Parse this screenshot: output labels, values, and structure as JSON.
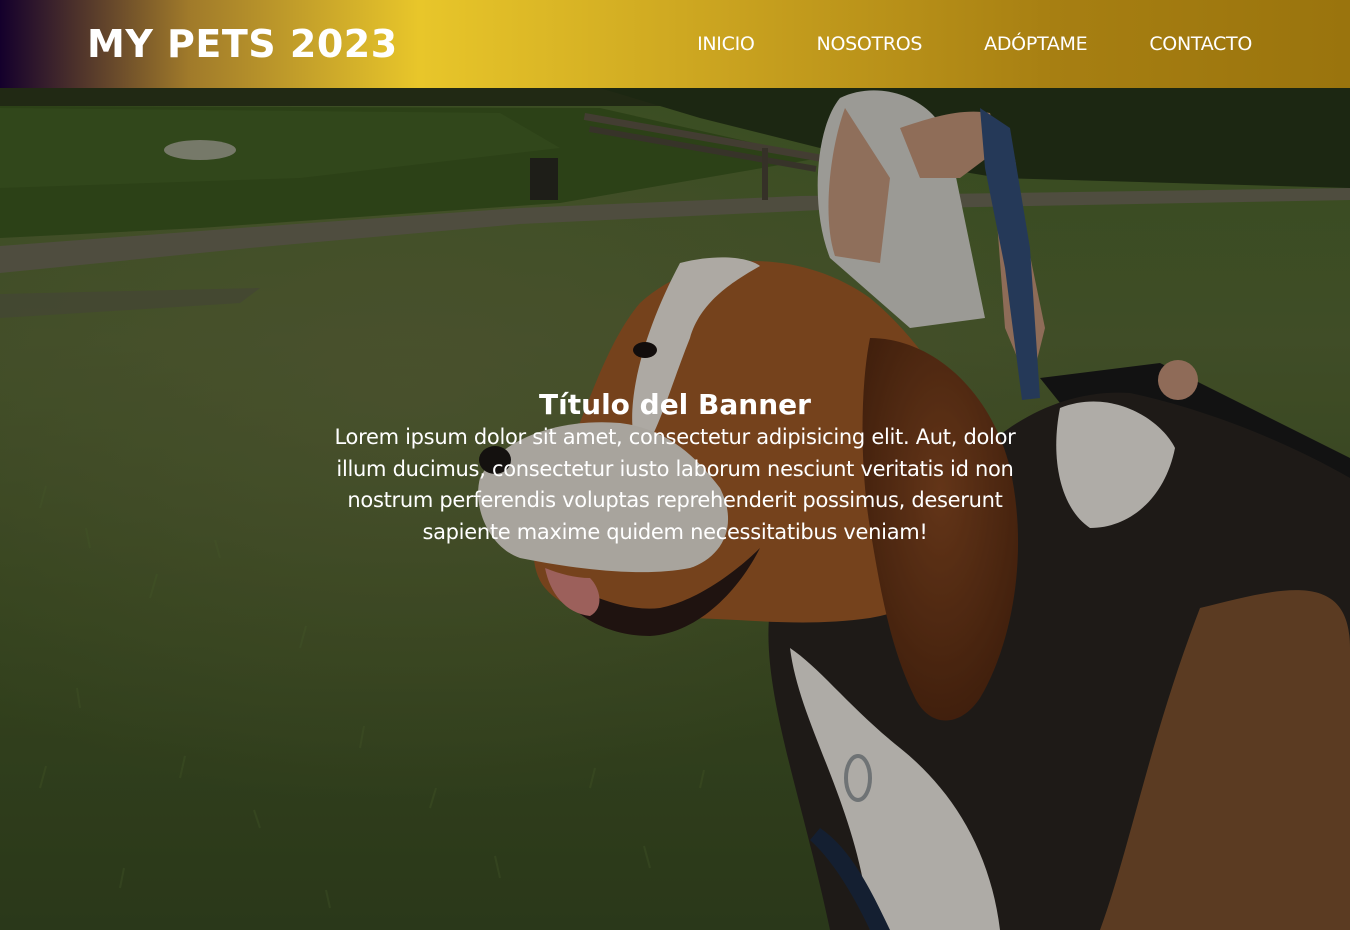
{
  "header": {
    "logo": "MY PETS 2023",
    "nav": [
      {
        "label": "INICIO"
      },
      {
        "label": "NOSOTROS"
      },
      {
        "label": "ADÓPTAME"
      },
      {
        "label": "CONTACTO"
      }
    ]
  },
  "banner": {
    "title": "Título del Banner",
    "text": "Lorem ipsum dolor sit amet, consectetur adipisicing elit. Aut, dolor illum ducimus, consectetur iusto laborum nesciunt veritatis id non nostrum perferendis voluptas reprehenderit possimus, deserunt sapiente maxime quidem necessitatibus veniam!"
  },
  "colors": {
    "header_gradient": [
      "#14002c",
      "#e8c62a",
      "#9a740d"
    ],
    "text": "#ffffff"
  }
}
